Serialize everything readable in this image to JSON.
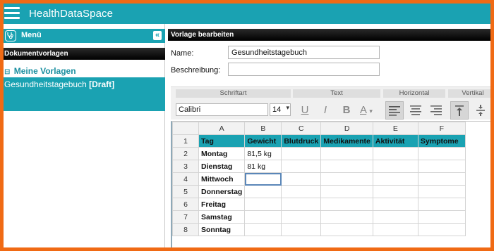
{
  "app": {
    "title": "HealthDataSpace"
  },
  "sidebar": {
    "menu_label": "Menü",
    "collapse_symbol": "«",
    "section_header": "Dokumentvorlagen",
    "group_toggle": "⊟",
    "group_label": "Meine Vorlagen",
    "document": {
      "name": "Gesundheitstagebuch",
      "status": "[Draft]"
    }
  },
  "main": {
    "header": "Vorlage bearbeiten",
    "name_label": "Name:",
    "name_value": "Gesundheitstagebuch",
    "description_label": "Beschreibung:",
    "description_value": ""
  },
  "ribbon": {
    "groups": {
      "font": "Schriftart",
      "text": "Text",
      "horizontal": "Horizontal",
      "vertical": "Vertikal"
    },
    "font_name": "Calibri",
    "font_size": "14",
    "dropdown_arrow": "▾",
    "buttons": {
      "underline": "U",
      "italic": "I",
      "bold": "B",
      "color": "A",
      "color_arrow": "▾"
    }
  },
  "sheet": {
    "columns": [
      "A",
      "B",
      "C",
      "D",
      "E",
      "F"
    ],
    "rows": [
      {
        "num": "1",
        "cells": [
          "Tag",
          "Gewicht",
          "Blutdruck",
          "Medikamente",
          "Aktivität",
          "Symptome"
        ]
      },
      {
        "num": "2",
        "cells": [
          "Montag",
          "81,5 kg",
          "",
          "",
          "",
          ""
        ]
      },
      {
        "num": "3",
        "cells": [
          "Dienstag",
          "81 kg",
          "",
          "",
          "",
          ""
        ]
      },
      {
        "num": "4",
        "cells": [
          "Mittwoch",
          "",
          "",
          "",
          "",
          ""
        ]
      },
      {
        "num": "5",
        "cells": [
          "Donnerstag",
          "",
          "",
          "",
          "",
          ""
        ]
      },
      {
        "num": "6",
        "cells": [
          "Freitag",
          "",
          "",
          "",
          "",
          ""
        ]
      },
      {
        "num": "7",
        "cells": [
          "Samstag",
          "",
          "",
          "",
          "",
          ""
        ]
      },
      {
        "num": "8",
        "cells": [
          "Sonntag",
          "",
          "",
          "",
          "",
          ""
        ]
      }
    ],
    "selected_cell": "B4"
  },
  "colors": {
    "accent": "#1aa2b2",
    "frame": "#f06a14",
    "header_dark": "#000000"
  }
}
